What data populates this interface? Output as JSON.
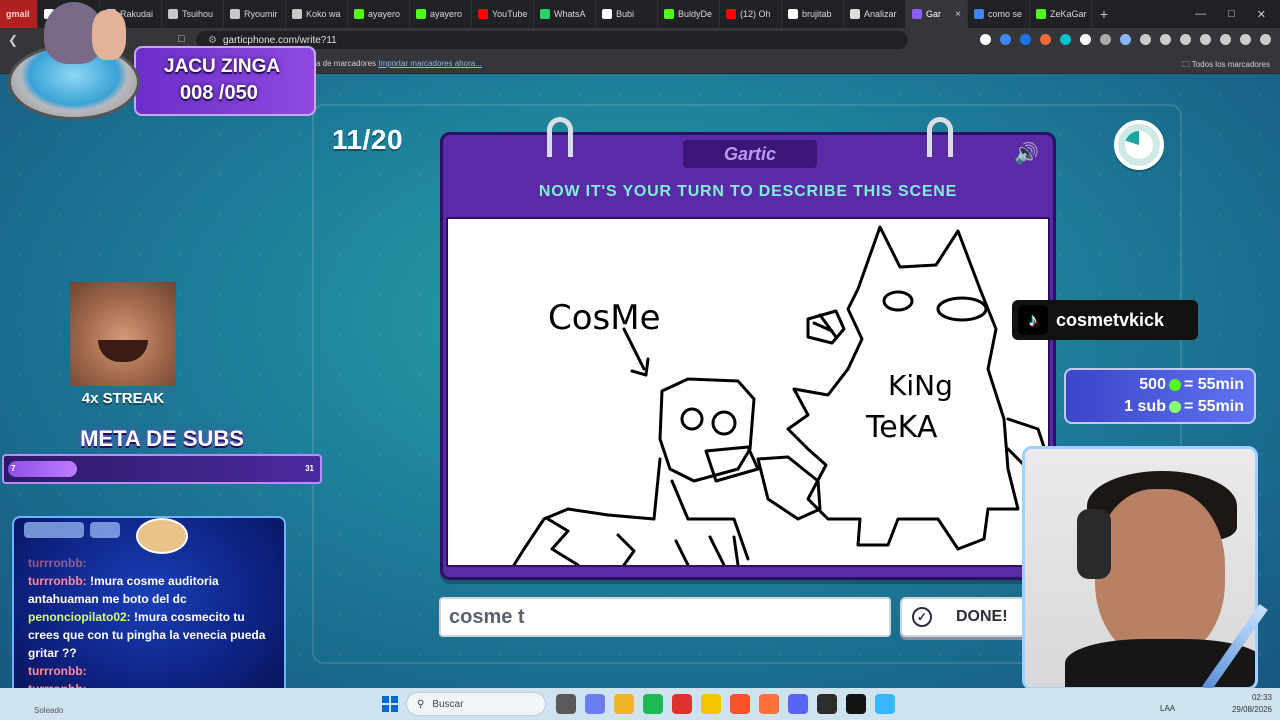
{
  "browser": {
    "tabs": [
      {
        "label": "gmail",
        "color": "#d93025",
        "kind": "gmail"
      },
      {
        "label": "",
        "color": "#ffffff"
      },
      {
        "label": "Rakudai",
        "color": "#c8c8c8"
      },
      {
        "label": "Tsuihou",
        "color": "#c8c8c8"
      },
      {
        "label": "Ryoumir",
        "color": "#c8c8c8"
      },
      {
        "label": "Koko wa",
        "color": "#c8c8c8"
      },
      {
        "label": "ayayero",
        "color": "#53fc18"
      },
      {
        "label": "ayayero",
        "color": "#53fc18"
      },
      {
        "label": "YouTube",
        "color": "#ff0000"
      },
      {
        "label": "WhatsA",
        "color": "#25d366"
      },
      {
        "label": "Bubi",
        "color": "#ffffff"
      },
      {
        "label": "BuldyDe",
        "color": "#53fc18"
      },
      {
        "label": "(12) Oh",
        "color": "#ff0000"
      },
      {
        "label": "brujitab",
        "color": "#ffffff"
      },
      {
        "label": "Analizar",
        "color": "#dddddd"
      },
      {
        "label": "Gar",
        "color": "#8b5cf6",
        "active": true
      },
      {
        "label": "como se",
        "color": "#4285f4"
      },
      {
        "label": "ZeKaGar",
        "color": "#53fc18"
      }
    ],
    "url": "garticphone.com/write?11",
    "bookmarks_left_prefix": "a de marcadores",
    "bookmarks_import": "Importar marcadores ahora...",
    "bookmarks_right": "Todos los marcadores",
    "extension_colors": [
      "#ffffff",
      "#4285f4",
      "#1a73e8",
      "#f06a35",
      "#00c4cc",
      "#ffffff",
      "#aaaaaa",
      "#8ab4f8",
      "#cccccc",
      "#cccccc",
      "#cccccc",
      "#cccccc",
      "#cccccc",
      "#cccccc",
      "#cccccc"
    ]
  },
  "game": {
    "round": "11/20",
    "logo": "Gartic",
    "instruction": "NOW IT'S YOUR TURN TO DESCRIBE THIS SCENE",
    "drawing_labels": {
      "cosme": "CosMe",
      "king": "KiNg",
      "teka": "TeKA"
    },
    "answer_value": "cosme t",
    "done_label": "DONE!",
    "timer_remaining": 0.8
  },
  "overlay": {
    "streamer_name": "JACU ZINGA",
    "streamer_count": "008 /050",
    "streak": "4x STREAK",
    "meta_title": "META DE SUBS",
    "meta_start": "7",
    "meta_end": "31",
    "meta_progress": 0.22,
    "tiktok_handle": "cosmetvkick",
    "promo_line1_amount": "500",
    "promo_line1_value": "= 55min",
    "promo_line2_amount": "1 sub",
    "promo_line2_value": "= 55min",
    "chat": [
      {
        "user": "turrronbb:",
        "text": "",
        "dim": true
      },
      {
        "user": "turrronbb:",
        "text": "!mura cosme auditoria antahuaman me boto del dc"
      },
      {
        "user": "penonciopilato02:",
        "text": "!mura cosmecito tu crees que con tu pingha la venecia pueda gritar ??",
        "green": true
      },
      {
        "user": "turrronbb:",
        "text": ""
      },
      {
        "user": "turrronbb:",
        "text": ""
      }
    ]
  },
  "taskbar": {
    "search_placeholder": "Buscar",
    "lang": "LAA",
    "time": "02:33",
    "date": "29/08/2026",
    "left_label": "Soleado",
    "icon_colors": [
      "#5a5a5a",
      "#6a7cf0",
      "#f0b429",
      "#1db954",
      "#e03131",
      "#f5c400",
      "#fb542b",
      "#ff7139",
      "#5865f2",
      "#2c2c2c",
      "#111111",
      "#38b6ff"
    ]
  }
}
